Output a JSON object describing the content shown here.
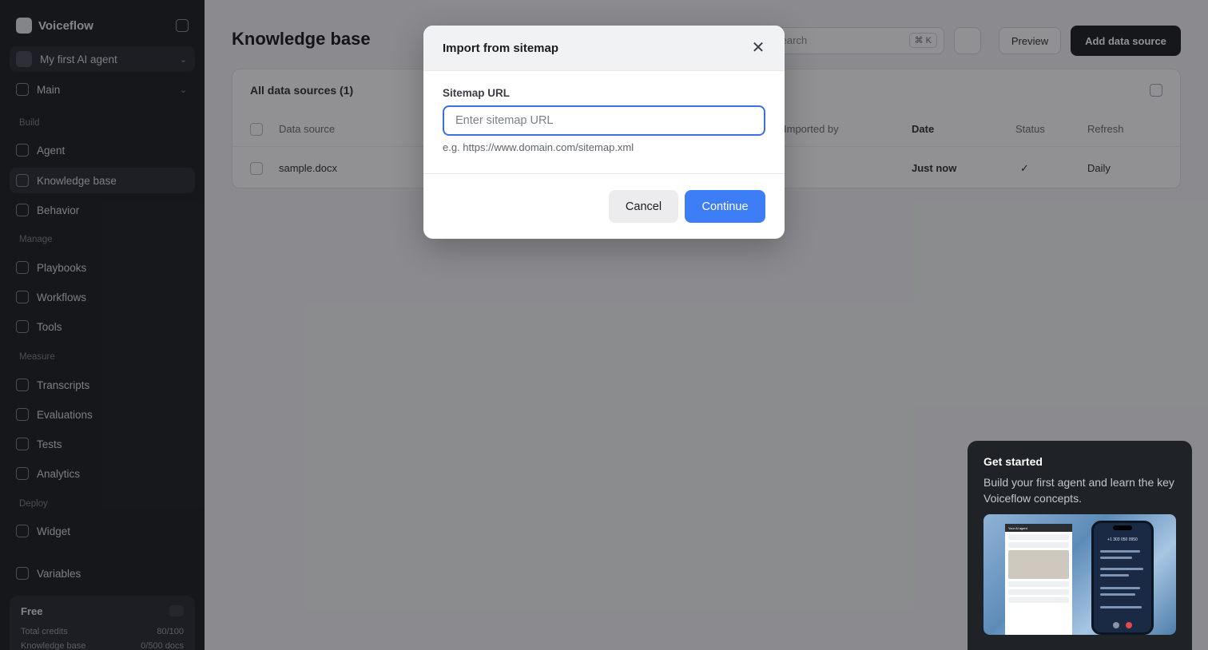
{
  "sidebar": {
    "brand": "Voiceflow",
    "project": "My first AI agent",
    "environment": "Main",
    "sections": [
      {
        "label": "Build",
        "items": [
          "Agent",
          "Knowledge base",
          "Behavior"
        ]
      },
      {
        "label": "Manage",
        "items": [
          "Playbooks",
          "Workflows",
          "Tools"
        ]
      },
      {
        "label": "Measure",
        "items": [
          "Transcripts",
          "Evaluations",
          "Tests",
          "Analytics"
        ]
      },
      {
        "label": "Deploy",
        "items": [
          "Widget"
        ]
      }
    ],
    "variables": "Variables",
    "plan": {
      "name": "Free",
      "line1_label": "Total credits",
      "line1_value": "80/100",
      "line2_label": "Knowledge base",
      "line2_value": "0/500 docs"
    }
  },
  "main": {
    "title": "Knowledge base",
    "search_placeholder": "Search",
    "search_shortcut": "⌘ K",
    "preview_label": "Preview",
    "add_label": "Add data source",
    "table": {
      "title": "All data sources (1)",
      "headers": [
        "Data source",
        "Imported by",
        "Date",
        "Status",
        "Refresh"
      ],
      "row": [
        "sample.docx",
        "",
        "Just now",
        "✓",
        "Daily"
      ]
    }
  },
  "modal": {
    "title": "Import from sitemap",
    "field_label": "Sitemap URL",
    "input_value": "",
    "input_placeholder": "Enter sitemap URL",
    "hint": "e.g. https://www.domain.com/sitemap.xml",
    "cancel_label": "Cancel",
    "continue_label": "Continue",
    "accent_color": "#3d7df5"
  },
  "get_started": {
    "title": "Get started",
    "description": "Build your first agent and learn the key Voiceflow concepts.",
    "preview_chat_title": "Your AI agent",
    "preview_phone_number": "+1 303 050 0950"
  }
}
